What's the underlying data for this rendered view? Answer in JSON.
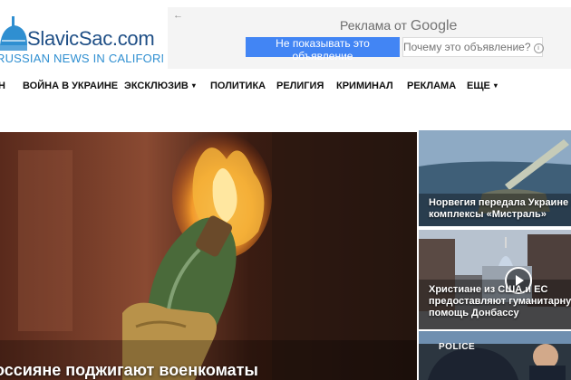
{
  "site": {
    "name": "SlavicSac.com",
    "tagline": "RUSSIAN NEWS IN CALIFORNIA"
  },
  "ad": {
    "back_icon": "arrow-left-icon",
    "title_prefix": "Реклама от",
    "title_brand": "Google",
    "primary_button": "Не показывать это объявление",
    "secondary_button": "Почему это объявление?",
    "secondary_icon": "info-icon"
  },
  "nav": {
    "items": [
      {
        "label": "Н"
      },
      {
        "label": "ВОЙНА В УКРАИНЕ"
      },
      {
        "label": "ЭКСКЛЮЗИВ",
        "chevron": "▾"
      },
      {
        "label": "ПОЛИТИКА"
      },
      {
        "label": "РЕЛИГИЯ"
      },
      {
        "label": "КРИМИНАЛ"
      },
      {
        "label": "РЕКЛАМА"
      },
      {
        "label": "ЕЩЕ",
        "chevron": "▾"
      }
    ]
  },
  "hero": {
    "title": "оссияне поджигают военкоматы"
  },
  "side": [
    {
      "line1": "Норвегия передала Украине зе",
      "line2": "комплексы «Мистраль»"
    },
    {
      "line1": "Христиане из США и ЕС",
      "line2": "предоставляют гуманитарную",
      "line3": "помощь Донбассу",
      "icon": "play-icon"
    },
    {
      "badge": "POLICE"
    }
  ],
  "colors": {
    "brand_blue": "#1f4f86",
    "tagline_blue": "#2f8fd1",
    "google_blue": "#4285f4"
  }
}
